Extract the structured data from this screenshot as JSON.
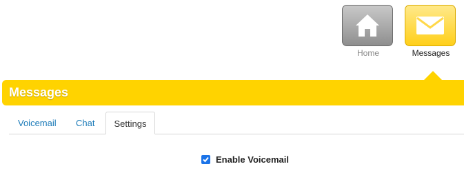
{
  "nav": {
    "home": {
      "label": "Home",
      "icon": "home-icon"
    },
    "messages": {
      "label": "Messages",
      "icon": "envelope-icon"
    }
  },
  "section": {
    "title": "Messages"
  },
  "tabs": [
    {
      "label": "Voicemail",
      "active": false
    },
    {
      "label": "Chat",
      "active": false
    },
    {
      "label": "Settings",
      "active": true
    }
  ],
  "settings": {
    "enable_voicemail": {
      "label": "Enable Voicemail",
      "checked": true
    }
  },
  "colors": {
    "accent": "#ffd300",
    "link": "#1a7ab8",
    "checkbox": "#1a73e8"
  }
}
